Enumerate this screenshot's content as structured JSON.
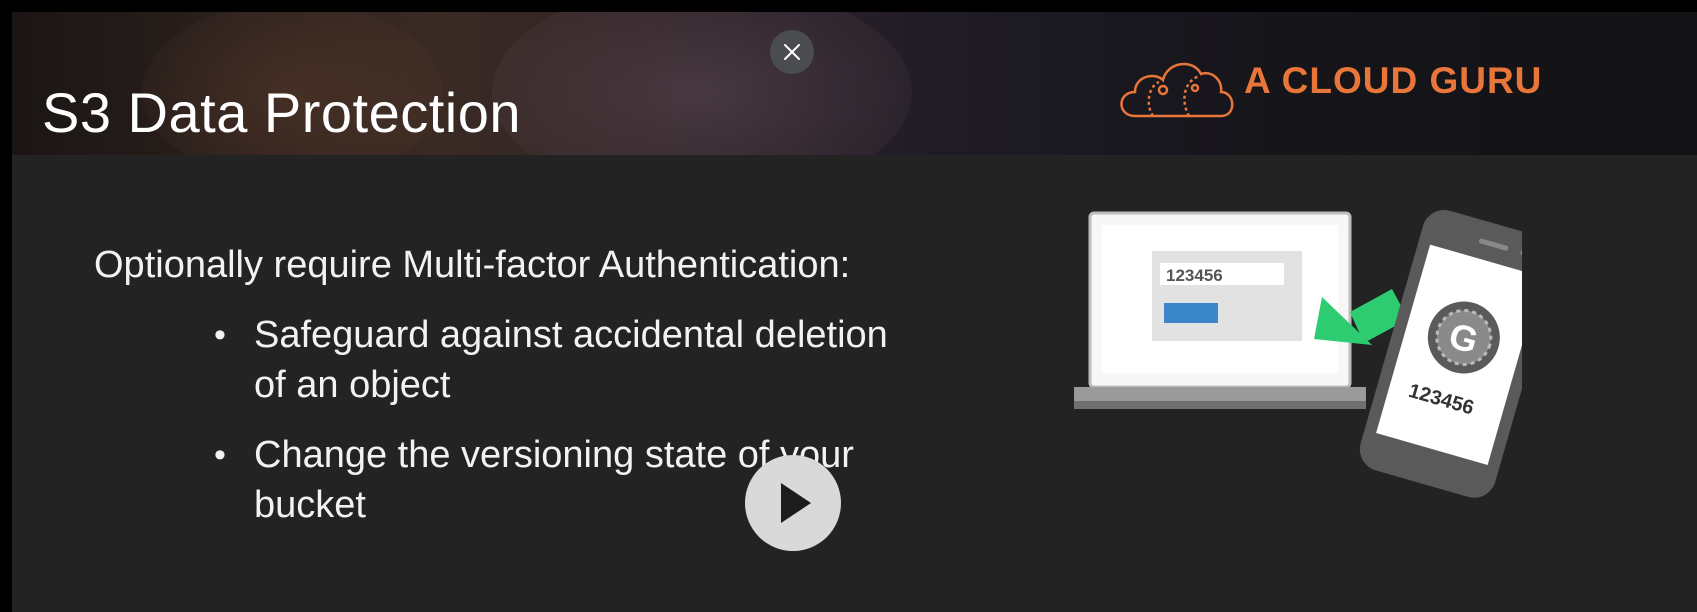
{
  "slide": {
    "title": "S3 Data Protection",
    "intro": "Optionally require Multi-factor Authentication:",
    "bullets": [
      "Safeguard against accidental deletion of an object",
      "Change the versioning state of your bucket"
    ]
  },
  "logo": {
    "text": "A CLOUD GURU",
    "color": "#e8763a"
  },
  "illustration": {
    "laptop_code": "123456",
    "phone_code": "123456",
    "phone_app_letter": "G",
    "arrow_color": "#2ecc71",
    "button_color": "#3b86c9"
  },
  "controls": {
    "close_icon": "close-icon",
    "play_icon": "play-icon"
  }
}
